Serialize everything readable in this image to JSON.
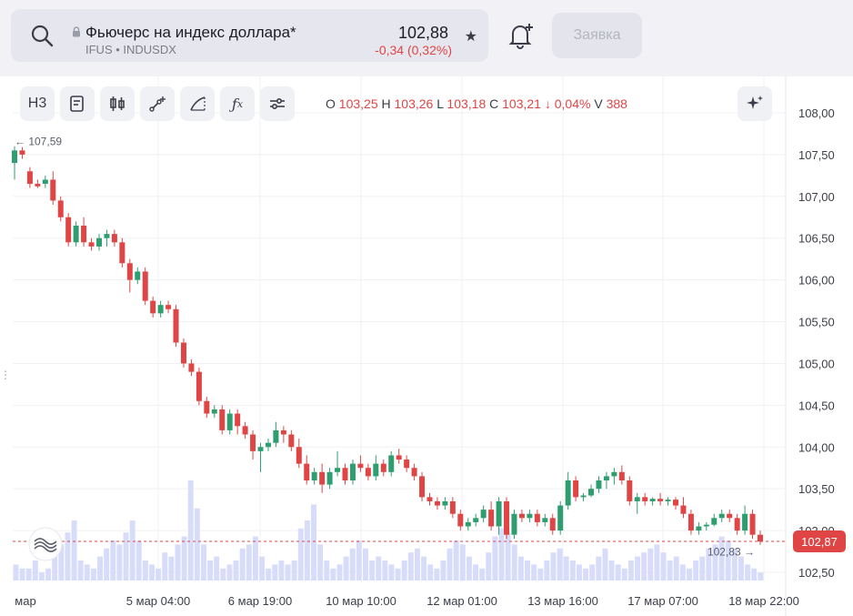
{
  "ticker": {
    "title": "Фьючерс на индекс доллара*",
    "codes": "IFUS • INDUSDX",
    "price": "102,88",
    "change": "-0,34 (0,32%)"
  },
  "actions": {
    "order_label": "Заявка"
  },
  "toolbar": {
    "interval_label": "Н3"
  },
  "ohlc": {
    "o_label": "O",
    "o": "103,25",
    "h_label": "H",
    "h": "103,26",
    "l_label": "L",
    "l": "103,18",
    "c_label": "C",
    "c": "103,21",
    "chg": "↓ 0,04%",
    "v_label": "V",
    "v": "388"
  },
  "chart_data": {
    "type": "candlestick",
    "y_ticks": [
      "108,00",
      "107,50",
      "107,00",
      "106,50",
      "106,00",
      "105,50",
      "105,00",
      "104,50",
      "104,00",
      "103,50",
      "103,00",
      "102,50"
    ],
    "ylim": [
      102.5,
      108.0
    ],
    "x_ticks": [
      "мар",
      "5 мар 04:00",
      "6 мар 19:00",
      "10 мар 10:00",
      "12 мар 01:00",
      "13 мар 16:00",
      "17 мар 07:00",
      "18 мар 22:00"
    ],
    "current_price_label": "102,87",
    "current_price": 102.87,
    "max_marker": {
      "label": "107,59",
      "value": 107.59
    },
    "min_marker": {
      "label": "102,83",
      "value": 102.83
    },
    "colors": {
      "up": "#2e9e70",
      "down": "#e04545",
      "volume": "#d6dcfa",
      "current": "#e04545"
    },
    "candles": [
      [
        107.4,
        107.6,
        107.2,
        107.55
      ],
      [
        107.55,
        107.59,
        107.45,
        107.5
      ],
      [
        107.3,
        107.35,
        107.1,
        107.15
      ],
      [
        107.15,
        107.2,
        107.1,
        107.12
      ],
      [
        107.15,
        107.25,
        107.1,
        107.2
      ],
      [
        107.2,
        107.3,
        106.9,
        106.95
      ],
      [
        106.95,
        107.0,
        106.7,
        106.75
      ],
      [
        106.75,
        106.8,
        106.4,
        106.45
      ],
      [
        106.45,
        106.7,
        106.4,
        106.65
      ],
      [
        106.65,
        106.75,
        106.4,
        106.45
      ],
      [
        106.45,
        106.5,
        106.35,
        106.4
      ],
      [
        106.4,
        106.55,
        106.35,
        106.5
      ],
      [
        106.5,
        106.6,
        106.4,
        106.55
      ],
      [
        106.55,
        106.6,
        106.4,
        106.45
      ],
      [
        106.45,
        106.5,
        106.15,
        106.2
      ],
      [
        106.2,
        106.25,
        105.85,
        106.0
      ],
      [
        106.0,
        106.15,
        105.95,
        106.1
      ],
      [
        106.1,
        106.15,
        105.7,
        105.75
      ],
      [
        105.75,
        105.8,
        105.55,
        105.6
      ],
      [
        105.6,
        105.75,
        105.55,
        105.7
      ],
      [
        105.7,
        105.75,
        105.6,
        105.65
      ],
      [
        105.65,
        105.7,
        105.2,
        105.25
      ],
      [
        105.25,
        105.3,
        104.95,
        105.0
      ],
      [
        105.0,
        105.05,
        104.85,
        104.9
      ],
      [
        104.9,
        104.95,
        104.5,
        104.55
      ],
      [
        104.55,
        104.6,
        104.35,
        104.4
      ],
      [
        104.4,
        104.5,
        104.35,
        104.45
      ],
      [
        104.45,
        104.5,
        104.15,
        104.2
      ],
      [
        104.2,
        104.45,
        104.15,
        104.4
      ],
      [
        104.4,
        104.45,
        104.15,
        104.25
      ],
      [
        104.25,
        104.3,
        104.1,
        104.15
      ],
      [
        104.15,
        104.2,
        103.85,
        103.95
      ],
      [
        103.95,
        104.05,
        103.7,
        104.0
      ],
      [
        104.0,
        104.1,
        103.95,
        104.05
      ],
      [
        104.05,
        104.3,
        104.0,
        104.2
      ],
      [
        104.2,
        104.25,
        104.05,
        104.15
      ],
      [
        104.15,
        104.2,
        103.95,
        104.0
      ],
      [
        104.0,
        104.1,
        103.75,
        103.8
      ],
      [
        103.8,
        103.9,
        103.55,
        103.6
      ],
      [
        103.6,
        103.75,
        103.55,
        103.7
      ],
      [
        103.7,
        103.8,
        103.45,
        103.55
      ],
      [
        103.55,
        103.75,
        103.5,
        103.7
      ],
      [
        103.7,
        103.95,
        103.65,
        103.75
      ],
      [
        103.75,
        103.8,
        103.55,
        103.6
      ],
      [
        103.6,
        103.85,
        103.55,
        103.8
      ],
      [
        103.8,
        103.9,
        103.7,
        103.75
      ],
      [
        103.75,
        103.8,
        103.6,
        103.65
      ],
      [
        103.65,
        103.9,
        103.6,
        103.8
      ],
      [
        103.8,
        103.85,
        103.65,
        103.7
      ],
      [
        103.7,
        103.95,
        103.65,
        103.9
      ],
      [
        103.9,
        103.98,
        103.8,
        103.85
      ],
      [
        103.85,
        103.9,
        103.7,
        103.75
      ],
      [
        103.75,
        103.8,
        103.6,
        103.65
      ],
      [
        103.65,
        103.7,
        103.35,
        103.4
      ],
      [
        103.4,
        103.45,
        103.3,
        103.35
      ],
      [
        103.35,
        103.4,
        103.25,
        103.3
      ],
      [
        103.3,
        103.4,
        103.25,
        103.35
      ],
      [
        103.35,
        103.4,
        103.15,
        103.2
      ],
      [
        103.2,
        103.25,
        103.0,
        103.05
      ],
      [
        103.05,
        103.15,
        103.0,
        103.1
      ],
      [
        103.1,
        103.2,
        103.05,
        103.15
      ],
      [
        103.15,
        103.3,
        103.1,
        103.25
      ],
      [
        103.25,
        103.35,
        103.0,
        103.05
      ],
      [
        103.05,
        103.4,
        102.95,
        103.35
      ],
      [
        103.35,
        103.4,
        102.9,
        102.95
      ],
      [
        102.95,
        103.25,
        102.9,
        103.2
      ],
      [
        103.2,
        103.25,
        103.1,
        103.15
      ],
      [
        103.15,
        103.25,
        103.1,
        103.2
      ],
      [
        103.2,
        103.25,
        103.05,
        103.1
      ],
      [
        103.1,
        103.2,
        103.05,
        103.15
      ],
      [
        103.15,
        103.2,
        102.95,
        103.0
      ],
      [
        103.0,
        103.35,
        102.95,
        103.3
      ],
      [
        103.3,
        103.7,
        103.25,
        103.6
      ],
      [
        103.6,
        103.65,
        103.35,
        103.4
      ],
      [
        103.4,
        103.45,
        103.35,
        103.42
      ],
      [
        103.42,
        103.55,
        103.4,
        103.5
      ],
      [
        103.5,
        103.65,
        103.45,
        103.6
      ],
      [
        103.6,
        103.7,
        103.5,
        103.65
      ],
      [
        103.65,
        103.75,
        103.55,
        103.7
      ],
      [
        103.7,
        103.78,
        103.55,
        103.6
      ],
      [
        103.6,
        103.65,
        103.3,
        103.35
      ],
      [
        103.35,
        103.45,
        103.2,
        103.4
      ],
      [
        103.4,
        103.45,
        103.3,
        103.35
      ],
      [
        103.35,
        103.4,
        103.3,
        103.38
      ],
      [
        103.38,
        103.45,
        103.3,
        103.35
      ],
      [
        103.35,
        103.4,
        103.3,
        103.37
      ],
      [
        103.37,
        103.4,
        103.25,
        103.3
      ],
      [
        103.3,
        103.4,
        103.15,
        103.2
      ],
      [
        103.2,
        103.25,
        102.95,
        103.0
      ],
      [
        103.0,
        103.1,
        102.95,
        103.05
      ],
      [
        103.05,
        103.1,
        103.0,
        103.07
      ],
      [
        103.07,
        103.2,
        103.05,
        103.15
      ],
      [
        103.15,
        103.25,
        103.1,
        103.2
      ],
      [
        103.2,
        103.25,
        103.1,
        103.15
      ],
      [
        103.15,
        103.2,
        102.95,
        103.0
      ],
      [
        103.0,
        103.3,
        102.95,
        103.2
      ],
      [
        103.2,
        103.25,
        102.9,
        102.95
      ],
      [
        102.95,
        103.0,
        102.83,
        102.87
      ]
    ],
    "volumes": [
      4,
      3,
      3,
      5,
      2,
      3,
      6,
      9,
      12,
      15,
      5,
      4,
      3,
      6,
      8,
      10,
      9,
      12,
      15,
      10,
      5,
      4,
      3,
      7,
      6,
      9,
      11,
      25,
      18,
      9,
      5,
      6,
      3,
      4,
      5,
      8,
      9,
      11,
      6,
      3,
      4,
      5,
      4,
      5,
      13,
      15,
      19,
      9,
      5,
      3,
      4,
      6,
      8,
      10,
      8,
      5,
      6,
      5,
      4,
      3,
      5,
      7,
      8,
      6,
      4,
      3,
      5,
      8,
      10,
      9,
      6,
      4,
      3,
      7,
      11,
      13,
      12,
      9,
      6,
      5,
      4,
      3,
      5,
      7,
      8,
      6,
      5,
      4,
      3,
      4,
      6,
      8,
      5,
      4,
      3,
      5,
      6,
      7,
      8,
      9,
      7,
      5,
      6,
      4,
      3,
      5,
      6,
      8,
      9,
      11,
      10,
      8,
      6,
      4,
      3,
      2
    ]
  }
}
